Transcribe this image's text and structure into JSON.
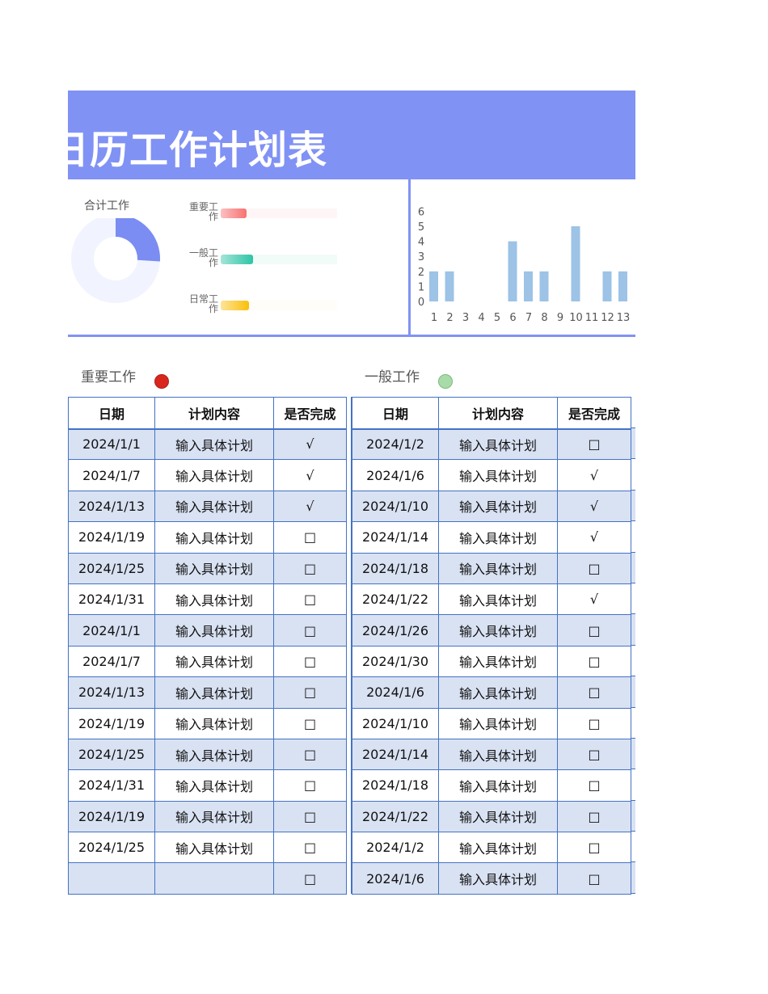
{
  "title": "日历工作计划表",
  "dashboard": {
    "donut": {
      "title": "合计工作",
      "fraction": 0.26,
      "colors": {
        "fill": "#7B8CF2",
        "rest": "#F1F4FE"
      }
    },
    "progress": [
      {
        "label": "重要工作",
        "value": 0.22,
        "color": "#F87171",
        "track": "#FEF6F6"
      },
      {
        "label": "一般工作",
        "value": 0.28,
        "color": "#2EC4A6",
        "track": "#F1FBF8"
      },
      {
        "label": "日常工作",
        "value": 0.24,
        "color": "#FBBF0A",
        "track": "#FEFDF8"
      }
    ]
  },
  "chart_data": {
    "type": "bar",
    "categories": [
      "1",
      "2",
      "3",
      "4",
      "5",
      "6",
      "7",
      "8",
      "9",
      "10",
      "11",
      "12",
      "13"
    ],
    "values": [
      2,
      2,
      0,
      0,
      0,
      4,
      2,
      2,
      0,
      5,
      0,
      2,
      2
    ],
    "ylim": [
      0,
      6
    ],
    "yticks": [
      "0",
      "1",
      "2",
      "3",
      "4",
      "5",
      "6"
    ],
    "color": "#9DC3E6"
  },
  "sections": [
    {
      "label": "重要工作",
      "color": "#D9261C"
    },
    {
      "label": "一般工作",
      "color": "#A8DBA8"
    }
  ],
  "headers": [
    "日期",
    "计划内容",
    "是否完成"
  ],
  "table_left": [
    [
      "2024/1/1",
      "输入具体计划",
      "√"
    ],
    [
      "2024/1/7",
      "输入具体计划",
      "√"
    ],
    [
      "2024/1/13",
      "输入具体计划",
      "√"
    ],
    [
      "2024/1/19",
      "输入具体计划",
      "□"
    ],
    [
      "2024/1/25",
      "输入具体计划",
      "□"
    ],
    [
      "2024/1/31",
      "输入具体计划",
      "□"
    ],
    [
      "2024/1/1",
      "输入具体计划",
      "□"
    ],
    [
      "2024/1/7",
      "输入具体计划",
      "□"
    ],
    [
      "2024/1/13",
      "输入具体计划",
      "□"
    ],
    [
      "2024/1/19",
      "输入具体计划",
      "□"
    ],
    [
      "2024/1/25",
      "输入具体计划",
      "□"
    ],
    [
      "2024/1/31",
      "输入具体计划",
      "□"
    ],
    [
      "2024/1/19",
      "输入具体计划",
      "□"
    ],
    [
      "2024/1/25",
      "输入具体计划",
      "□"
    ],
    [
      "",
      "",
      "□"
    ]
  ],
  "table_right": [
    [
      "2024/1/2",
      "输入具体计划",
      "□"
    ],
    [
      "2024/1/6",
      "输入具体计划",
      "√"
    ],
    [
      "2024/1/10",
      "输入具体计划",
      "√"
    ],
    [
      "2024/1/14",
      "输入具体计划",
      "√"
    ],
    [
      "2024/1/18",
      "输入具体计划",
      "□"
    ],
    [
      "2024/1/22",
      "输入具体计划",
      "√"
    ],
    [
      "2024/1/26",
      "输入具体计划",
      "□"
    ],
    [
      "2024/1/30",
      "输入具体计划",
      "□"
    ],
    [
      "2024/1/6",
      "输入具体计划",
      "□"
    ],
    [
      "2024/1/10",
      "输入具体计划",
      "□"
    ],
    [
      "2024/1/14",
      "输入具体计划",
      "□"
    ],
    [
      "2024/1/18",
      "输入具体计划",
      "□"
    ],
    [
      "2024/1/22",
      "输入具体计划",
      "□"
    ],
    [
      "2024/1/2",
      "输入具体计划",
      "□"
    ],
    [
      "2024/1/6",
      "输入具体计划",
      "□"
    ]
  ]
}
